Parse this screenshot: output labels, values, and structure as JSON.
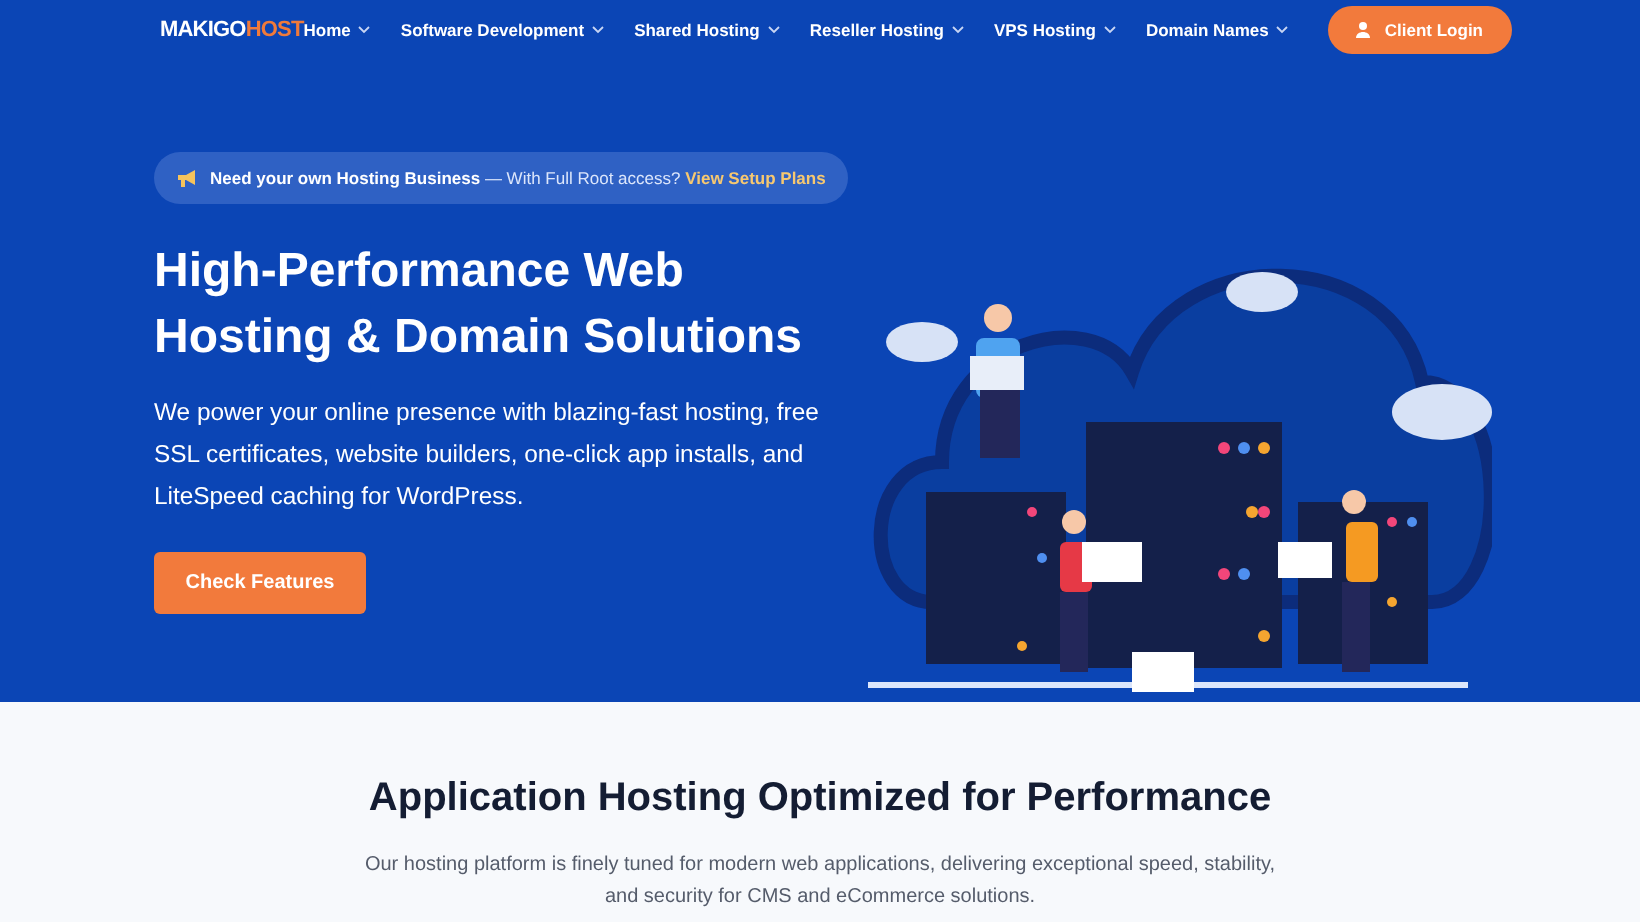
{
  "header": {
    "logo": {
      "main": "MAKIGO",
      "accent": "HOST"
    },
    "nav": [
      {
        "label": "Home",
        "dropdown": true
      },
      {
        "label": "Software Development",
        "dropdown": true
      },
      {
        "label": "Shared Hosting",
        "dropdown": true
      },
      {
        "label": "Reseller Hosting",
        "dropdown": true
      },
      {
        "label": "VPS Hosting",
        "dropdown": true
      },
      {
        "label": "Domain Names",
        "dropdown": true
      }
    ],
    "login_button": "Client Login"
  },
  "hero": {
    "announcement": {
      "text": "**Need your own Hosting Business** — With Full Root access?",
      "link": "View Setup Plans"
    },
    "title": "High-Performance Web Hosting & Domain Solutions",
    "description": "We power your online presence with blazing-fast hosting, free SSL certificates, website builders, one-click app installs, and LiteSpeed caching for WordPress.",
    "cta": "Check Features"
  },
  "section": {
    "title": "Application Hosting Optimized for Performance",
    "text": "Our hosting platform is finely tuned for modern web applications, delivering exceptional speed, stability, and security for CMS and eCommerce solutions."
  }
}
